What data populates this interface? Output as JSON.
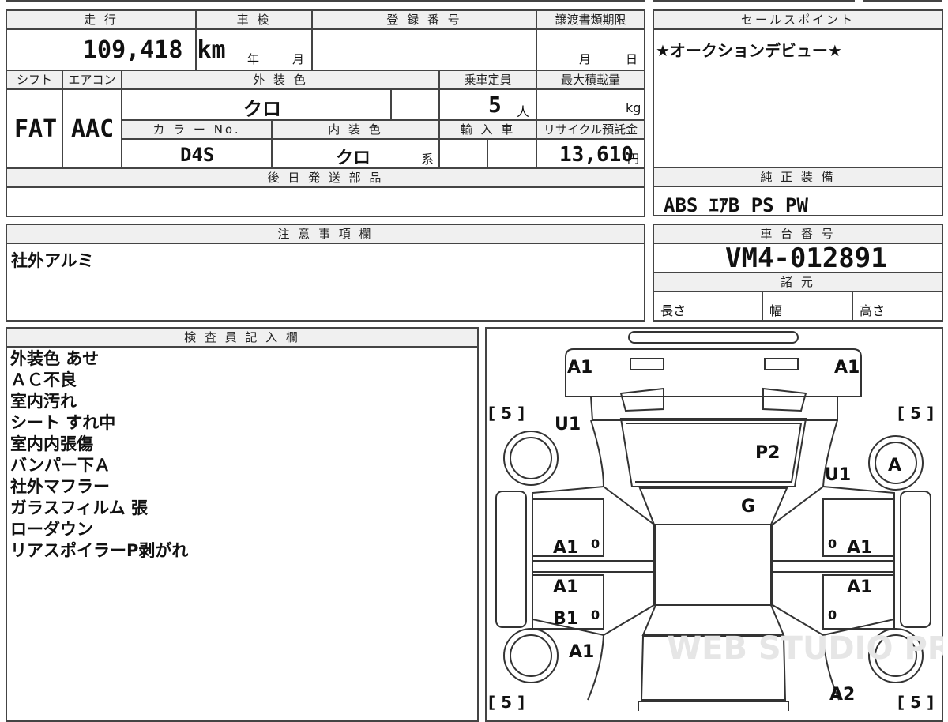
{
  "fields": {
    "mileage_label": "走 行",
    "mileage_value": "109,418 km",
    "inspection_label": "車 検",
    "inspection_year": "年",
    "inspection_month": "月",
    "registration_label": "登 録 番 号",
    "transfer_label": "譲渡書類期限",
    "transfer_month": "月",
    "transfer_day": "日",
    "shift_label": "シフト",
    "shift_value": "FAT",
    "ac_label": "エアコン",
    "ac_value": "AAC",
    "exterior_label": "外 装 色",
    "exterior_value": "クロ",
    "capacity_label": "乗車定員",
    "capacity_value": "5",
    "capacity_unit": "人",
    "maxload_label": "最大積載量",
    "maxload_unit": "kg",
    "colorno_label": "カ ラ ー No.",
    "colorno_value": "D4S",
    "interior_label": "内 装 色",
    "interior_value": "クロ",
    "interior_suffix": "系",
    "import_label": "輸 入 車",
    "recycle_label": "リサイクル預託金",
    "recycle_value": "13,610",
    "recycle_unit": "円",
    "later_parts_label": "後 日 発 送 部 品"
  },
  "sales_point": {
    "label": "セールスポイント",
    "text": "★オークションデビュー★"
  },
  "equipment": {
    "label": "純 正 装 備",
    "text": "ABS ｴｱB PS PW"
  },
  "notes": {
    "label": "注 意 事 項 欄",
    "text": "社外アルミ"
  },
  "chassis": {
    "label": "車 台 番 号",
    "value": "VM4-012891",
    "spec_label": "諸 元",
    "length_label": "長さ",
    "width_label": "幅",
    "height_label": "高さ"
  },
  "inspector": {
    "label": "検 査 員 記 入 欄",
    "items": [
      "外装色 あせ",
      "ＡＣ不良",
      "室内汚れ",
      "シート すれ中",
      "室内内張傷",
      "バンパー下Ａ",
      "社外マフラー",
      "ガラスフィルム 張",
      "ローダウン",
      "リアスポイラーP剥がれ"
    ]
  },
  "diagram": {
    "front_left": "A1",
    "front_right": "A1",
    "tire_fl": "[ 5 ]",
    "tire_fr": "[ 5 ]",
    "tire_rl": "[ 5 ]",
    "tire_rr": "[ 5 ]",
    "fender_left": "U1",
    "fender_right": "U1",
    "hood": "P2",
    "windshield": "G",
    "wheel_right": "A",
    "door_fl": "A1",
    "door_rl": "A1",
    "sill_left": "B1",
    "door_fr": "A1",
    "door_rr": "A1",
    "rear_left": "A1",
    "rear_right": "A2",
    "zero": "0",
    "watermark": "WEB STUDIO PRO"
  }
}
